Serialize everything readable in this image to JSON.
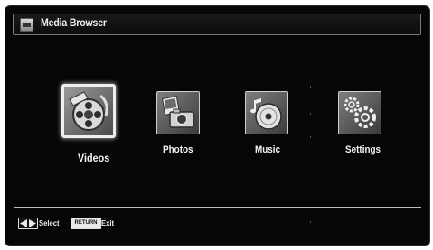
{
  "header": {
    "icon": "media-browser-icon",
    "title": "Media Browser"
  },
  "menu": {
    "selected_index": 0,
    "items": [
      {
        "label": "Videos",
        "icon": "film-reel-icon"
      },
      {
        "label": "Photos",
        "icon": "photo-camera-icon"
      },
      {
        "label": "Music",
        "icon": "music-disc-icon"
      },
      {
        "label": "Settings",
        "icon": "gears-icon"
      }
    ]
  },
  "footer": {
    "select_hint": "Select",
    "return_key_label": "RETURN",
    "exit_hint": "Exit"
  }
}
